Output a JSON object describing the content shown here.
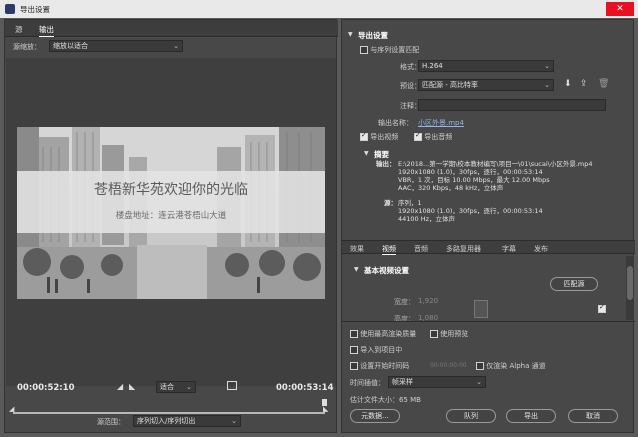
{
  "window": {
    "title": "导出设置",
    "close": "✕"
  },
  "left": {
    "tabs": [
      "源",
      "输出"
    ],
    "scale_label": "源缩放：",
    "scale_value": "缩放以适合",
    "preview": {
      "headline": "苍梧新华苑欢迎你的光临",
      "address": "楼盘地址：连云港苍梧山大道"
    },
    "time_in": "00:00:52:10",
    "time_out": "00:00:53:14",
    "fit_value": "适合",
    "range_label": "源范围：",
    "range_value": "序列切入/序列切出"
  },
  "right": {
    "export_settings_title": "导出设置",
    "match_sequence": "与序列设置匹配",
    "format_label": "格式：",
    "format_value": "H.264",
    "preset_label": "预设：",
    "preset_value": "匹配源 - 高比特率",
    "comment_label": "注释：",
    "output_name_label": "输出名称：",
    "output_name_value": "小区外景.mp4",
    "export_video": "导出视频",
    "export_audio": "导出音频",
    "summary_title": "摘要",
    "output_label": "输出：",
    "output_lines": [
      "E:\\2018...第一学期\\校本教材编写\\项目一\\01\\sucai\\小区外景.mp4",
      "1920x1080 (1.0)，30fps，逐行，00:00:53:14",
      "VBR，1 次，目标 10.00 Mbps，最大 12.00 Mbps",
      "AAC，320 Kbps，48 kHz，立体声"
    ],
    "source_label": "源：",
    "source_lines": [
      "序列，1",
      "1920x1080 (1.0)，30fps，逐行，00:00:53:14",
      "44100 Hz，立体声"
    ],
    "tabs": [
      "效果",
      "视频",
      "音频",
      "多路复用器",
      "字幕",
      "发布"
    ],
    "basic_video_title": "基本视频设置",
    "match_source_btn": "匹配源",
    "width_label": "宽度：",
    "width_value": "1,920",
    "height_label": "高度：",
    "height_value": "1,080",
    "max_render": "使用最高渲染质量",
    "use_preview": "使用预览",
    "import_project": "导入到项目中",
    "set_timecode": "设置开始时间码",
    "timecode_value": "00:00:00:00",
    "render_alpha": "仅渲染 Alpha 通道",
    "interp_label": "时间插值：",
    "interp_value": "帧采样",
    "filesize": "估计文件大小：65 MB",
    "buttons": {
      "metadata": "元数据...",
      "queue": "队列",
      "export": "导出",
      "cancel": "取消"
    }
  }
}
